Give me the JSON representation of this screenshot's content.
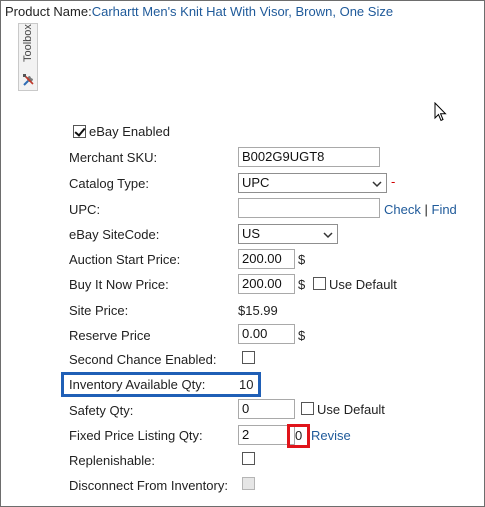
{
  "header": {
    "product_label": "Product Name:",
    "product_name": "Carhartt Men's Knit Hat With Visor, Brown, One Size"
  },
  "toolbox": {
    "label": "Toolbox",
    "icon": "tools-icon"
  },
  "form": {
    "ebay_enabled": {
      "label": "eBay Enabled",
      "checked": true
    },
    "merchant_sku": {
      "label": "Merchant SKU:",
      "value": "B002G9UGT8"
    },
    "catalog_type": {
      "label": "Catalog Type:",
      "value": "UPC",
      "required_mark": "-"
    },
    "upc": {
      "label": "UPC:",
      "value": "",
      "check_link": "Check",
      "separator": "|",
      "find_link": "Find"
    },
    "ebay_sitecode": {
      "label": "eBay SiteCode:",
      "value": "US"
    },
    "auction_start_price": {
      "label": "Auction Start Price:",
      "value": "200.00",
      "currency": "$"
    },
    "buy_it_now_price": {
      "label": "Buy It Now Price:",
      "value": "200.00",
      "currency": "$",
      "use_default_label": "Use Default",
      "use_default_checked": false
    },
    "site_price": {
      "label": "Site Price:",
      "value": "$15.99"
    },
    "reserve_price": {
      "label": "Reserve Price",
      "value": "0.00",
      "currency": "$"
    },
    "second_chance": {
      "label": "Second Chance Enabled:",
      "checked": false
    },
    "inventory_available_qty": {
      "label": "Inventory Available Qty:",
      "value": "10"
    },
    "safety_qty": {
      "label": "Safety Qty:",
      "value": "0",
      "use_default_label": "Use Default",
      "use_default_checked": false
    },
    "fixed_price_listing_qty": {
      "label": "Fixed Price Listing Qty:",
      "value": "2",
      "listed_value": "0",
      "revise_link": "Revise"
    },
    "replenishable": {
      "label": "Replenishable:",
      "checked": false
    },
    "disconnect_from_inventory": {
      "label": "Disconnect From Inventory:",
      "checked": false,
      "disabled": true
    }
  },
  "colors": {
    "link": "#1f5a9a",
    "highlight_blue": "#1f5fb6",
    "highlight_red": "#e0141a",
    "required": "#d10000"
  }
}
